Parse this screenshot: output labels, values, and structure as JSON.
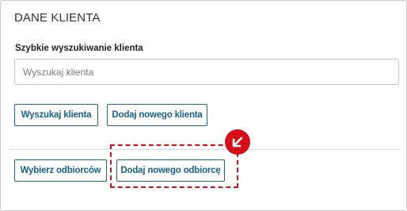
{
  "panel": {
    "title": "DANE KLIENTA"
  },
  "search": {
    "label": "Szybkie wyszukiwanie klienta",
    "placeholder": "Wyszukaj klienta",
    "value": ""
  },
  "actions": {
    "search_client_label": "Wyszukaj klienta",
    "add_client_label": "Dodaj nowego klienta"
  },
  "recipients": {
    "choose_label": "Wybierz odbiorców",
    "add_recipient_label": "Dodaj nowego odbiorcę"
  },
  "annotation": {
    "highlight_color": "#d40f18",
    "marker_icon": "arrow-down-left-icon"
  },
  "colors": {
    "accent": "#1a6694",
    "annotation": "#d40f18"
  }
}
